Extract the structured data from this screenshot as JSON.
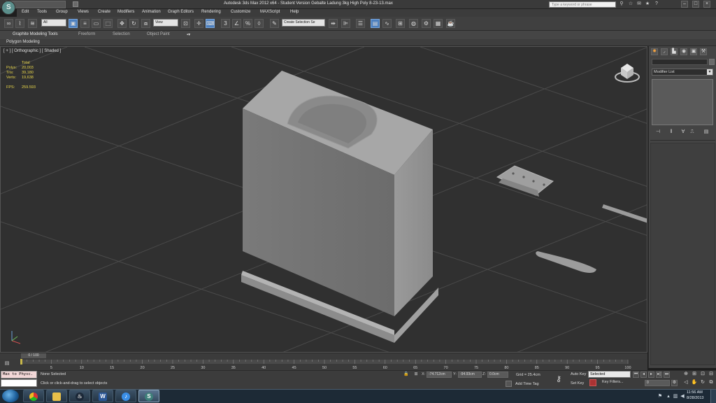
{
  "window": {
    "title": "Autodesk 3ds Max  2012 x64   - Student Version    Gebalte Ladung 3kg High Poly 8-23-13.max",
    "search_placeholder": "Type a keyword or phrase"
  },
  "menu": [
    "Edit",
    "Tools",
    "Group",
    "Views",
    "Create",
    "Modifiers",
    "Animation",
    "Graph Editors",
    "Rendering",
    "Customize",
    "MAXScript",
    "Help"
  ],
  "toolbar": {
    "selection_filter": "All",
    "reference_coord": "View",
    "named_selection": "Create Selection Se"
  },
  "ribbon": {
    "tabs": [
      "Graphite Modeling Tools",
      "Freeform",
      "Selection",
      "Object Paint"
    ],
    "panel": "Polygon Modeling"
  },
  "viewport": {
    "label": "[ + ] [ Orthographic ] [ Shaded ]",
    "stats_header": "Total",
    "stats": [
      {
        "label": "Polys:",
        "value": "20,003"
      },
      {
        "label": "Tris:",
        "value": "39,180"
      },
      {
        "label": "Verts:",
        "value": "19,638"
      }
    ],
    "fps_label": "FPS:",
    "fps_value": "259.593"
  },
  "command_panel": {
    "modifier_list": "Modifier List"
  },
  "timeline": {
    "frame_counter": "0 / 100",
    "ticks": [
      0,
      5,
      10,
      15,
      20,
      25,
      30,
      35,
      40,
      45,
      50,
      55,
      60,
      65,
      70,
      75,
      80,
      85,
      90,
      95,
      100
    ]
  },
  "status": {
    "maxscript_listener": "Max to Physc.",
    "selection_status": "None Selected",
    "prompt": "Click or click-and-drag to select objects",
    "x_label": "X:",
    "x_value": "-74.712cm",
    "y_label": "Y:",
    "y_value": "-94.93cm",
    "z_label": "Z:",
    "z_value": "0.0cm",
    "grid": "Grid = 25.4cm",
    "add_time_tag": "Add Time Tag",
    "auto_key": "Auto Key",
    "set_key": "Set Key",
    "key_mode": "Selected",
    "key_filters": "Key Filters...",
    "current_frame": "0"
  },
  "taskbar": {
    "time": "11:56 AM",
    "date": "8/28/2013"
  },
  "colors": {
    "stats_text": "#e8d64a",
    "viewport_bg": "#303030",
    "active_tool": "#4b7fbf",
    "maxscript_bg": "#f2d7d7"
  }
}
